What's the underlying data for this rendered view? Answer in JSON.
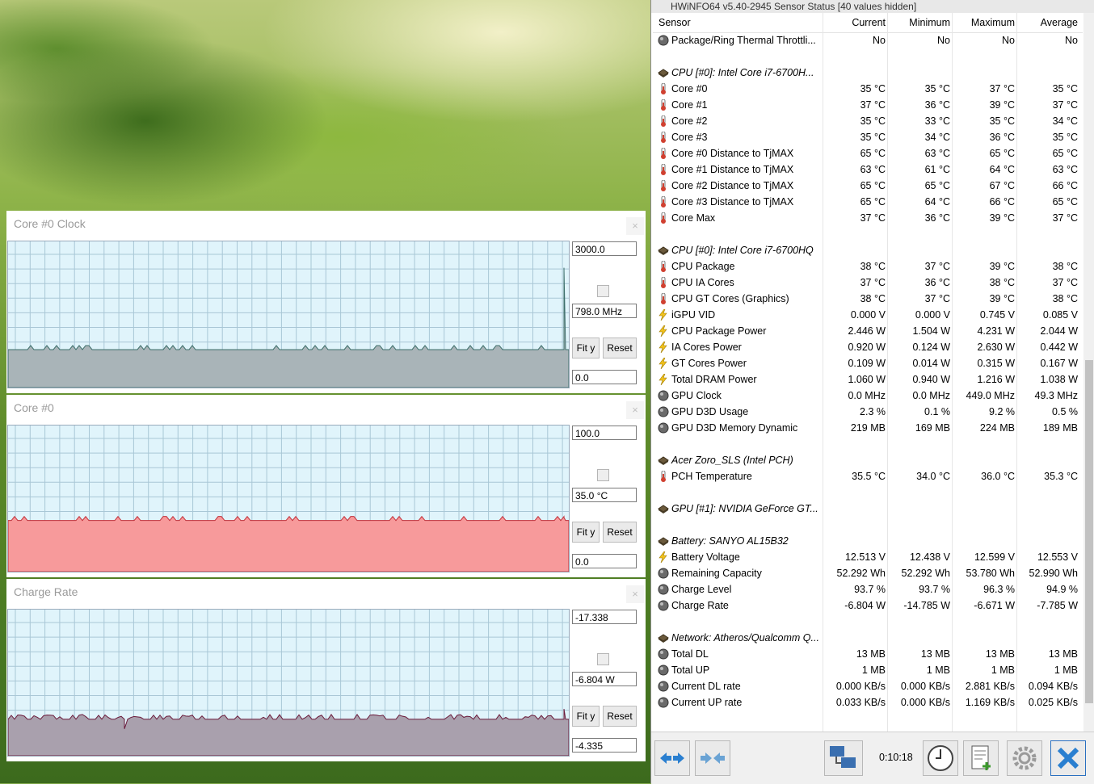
{
  "hwinfo": {
    "title": "HWiNFO64 v5.40-2945 Sensor Status [40 values hidden]",
    "headers": {
      "sensor": "Sensor",
      "current": "Current",
      "minimum": "Minimum",
      "maximum": "Maximum",
      "average": "Average"
    },
    "rows": [
      {
        "type": "item",
        "icon": "circle-icon",
        "name": "Package/Ring Thermal Throttli...",
        "cur": "No",
        "min": "No",
        "max": "No",
        "avg": "No"
      },
      {
        "type": "blank"
      },
      {
        "type": "group",
        "icon": "chip-icon",
        "name": "CPU [#0]: Intel Core i7-6700H..."
      },
      {
        "type": "item",
        "icon": "thermometer-icon",
        "name": "Core #0",
        "cur": "35 °C",
        "min": "35 °C",
        "max": "37 °C",
        "avg": "35 °C"
      },
      {
        "type": "item",
        "icon": "thermometer-icon",
        "name": "Core #1",
        "cur": "37 °C",
        "min": "36 °C",
        "max": "39 °C",
        "avg": "37 °C"
      },
      {
        "type": "item",
        "icon": "thermometer-icon",
        "name": "Core #2",
        "cur": "35 °C",
        "min": "33 °C",
        "max": "35 °C",
        "avg": "34 °C"
      },
      {
        "type": "item",
        "icon": "thermometer-icon",
        "name": "Core #3",
        "cur": "35 °C",
        "min": "34 °C",
        "max": "36 °C",
        "avg": "35 °C"
      },
      {
        "type": "item",
        "icon": "thermometer-icon",
        "name": "Core #0 Distance to TjMAX",
        "cur": "65 °C",
        "min": "63 °C",
        "max": "65 °C",
        "avg": "65 °C"
      },
      {
        "type": "item",
        "icon": "thermometer-icon",
        "name": "Core #1 Distance to TjMAX",
        "cur": "63 °C",
        "min": "61 °C",
        "max": "64 °C",
        "avg": "63 °C"
      },
      {
        "type": "item",
        "icon": "thermometer-icon",
        "name": "Core #2 Distance to TjMAX",
        "cur": "65 °C",
        "min": "65 °C",
        "max": "67 °C",
        "avg": "66 °C"
      },
      {
        "type": "item",
        "icon": "thermometer-icon",
        "name": "Core #3 Distance to TjMAX",
        "cur": "65 °C",
        "min": "64 °C",
        "max": "66 °C",
        "avg": "65 °C"
      },
      {
        "type": "item",
        "icon": "thermometer-icon",
        "name": "Core Max",
        "cur": "37 °C",
        "min": "36 °C",
        "max": "39 °C",
        "avg": "37 °C"
      },
      {
        "type": "blank"
      },
      {
        "type": "group",
        "icon": "chip-icon",
        "name": "CPU [#0]: Intel Core i7-6700HQ"
      },
      {
        "type": "item",
        "icon": "thermometer-icon",
        "name": "CPU Package",
        "cur": "38 °C",
        "min": "37 °C",
        "max": "39 °C",
        "avg": "38 °C"
      },
      {
        "type": "item",
        "icon": "thermometer-icon",
        "name": "CPU IA Cores",
        "cur": "37 °C",
        "min": "36 °C",
        "max": "38 °C",
        "avg": "37 °C"
      },
      {
        "type": "item",
        "icon": "thermometer-icon",
        "name": "CPU GT Cores (Graphics)",
        "cur": "38 °C",
        "min": "37 °C",
        "max": "39 °C",
        "avg": "38 °C"
      },
      {
        "type": "item",
        "icon": "lightning-icon",
        "name": "iGPU VID",
        "cur": "0.000 V",
        "min": "0.000 V",
        "max": "0.745 V",
        "avg": "0.085 V"
      },
      {
        "type": "item",
        "icon": "lightning-icon",
        "name": "CPU Package Power",
        "cur": "2.446 W",
        "min": "1.504 W",
        "max": "4.231 W",
        "avg": "2.044 W"
      },
      {
        "type": "item",
        "icon": "lightning-icon",
        "name": "IA Cores Power",
        "cur": "0.920 W",
        "min": "0.124 W",
        "max": "2.630 W",
        "avg": "0.442 W"
      },
      {
        "type": "item",
        "icon": "lightning-icon",
        "name": "GT Cores Power",
        "cur": "0.109 W",
        "min": "0.014 W",
        "max": "0.315 W",
        "avg": "0.167 W"
      },
      {
        "type": "item",
        "icon": "lightning-icon",
        "name": "Total DRAM Power",
        "cur": "1.060 W",
        "min": "0.940 W",
        "max": "1.216 W",
        "avg": "1.038 W"
      },
      {
        "type": "item",
        "icon": "circle-icon",
        "name": "GPU Clock",
        "cur": "0.0 MHz",
        "min": "0.0 MHz",
        "max": "449.0 MHz",
        "avg": "49.3 MHz"
      },
      {
        "type": "item",
        "icon": "circle-icon",
        "name": "GPU D3D Usage",
        "cur": "2.3 %",
        "min": "0.1 %",
        "max": "9.2 %",
        "avg": "0.5 %"
      },
      {
        "type": "item",
        "icon": "circle-icon",
        "name": "GPU D3D Memory Dynamic",
        "cur": "219 MB",
        "min": "169 MB",
        "max": "224 MB",
        "avg": "189 MB"
      },
      {
        "type": "blank"
      },
      {
        "type": "group",
        "icon": "chip-icon",
        "name": "Acer Zoro_SLS (Intel PCH)"
      },
      {
        "type": "item",
        "icon": "thermometer-icon",
        "name": "PCH Temperature",
        "cur": "35.5 °C",
        "min": "34.0 °C",
        "max": "36.0 °C",
        "avg": "35.3 °C"
      },
      {
        "type": "blank"
      },
      {
        "type": "group",
        "icon": "chip-icon",
        "name": "GPU [#1]: NVIDIA GeForce GT..."
      },
      {
        "type": "blank"
      },
      {
        "type": "group",
        "icon": "chip-icon",
        "name": "Battery: SANYO AL15B32"
      },
      {
        "type": "item",
        "icon": "lightning-icon",
        "name": "Battery Voltage",
        "cur": "12.513 V",
        "min": "12.438 V",
        "max": "12.599 V",
        "avg": "12.553 V"
      },
      {
        "type": "item",
        "icon": "circle-icon",
        "name": "Remaining Capacity",
        "cur": "52.292 Wh",
        "min": "52.292 Wh",
        "max": "53.780 Wh",
        "avg": "52.990 Wh"
      },
      {
        "type": "item",
        "icon": "circle-icon",
        "name": "Charge Level",
        "cur": "93.7 %",
        "min": "93.7 %",
        "max": "96.3 %",
        "avg": "94.9 %"
      },
      {
        "type": "item",
        "icon": "circle-icon",
        "name": "Charge Rate",
        "cur": "-6.804 W",
        "min": "-14.785 W",
        "max": "-6.671 W",
        "avg": "-7.785 W"
      },
      {
        "type": "blank"
      },
      {
        "type": "group",
        "icon": "chip-icon",
        "name": "Network: Atheros/Qualcomm Q..."
      },
      {
        "type": "item",
        "icon": "circle-icon",
        "name": "Total DL",
        "cur": "13 MB",
        "min": "13 MB",
        "max": "13 MB",
        "avg": "13 MB"
      },
      {
        "type": "item",
        "icon": "circle-icon",
        "name": "Total UP",
        "cur": "1 MB",
        "min": "1 MB",
        "max": "1 MB",
        "avg": "1 MB"
      },
      {
        "type": "item",
        "icon": "circle-icon",
        "name": "Current DL rate",
        "cur": "0.000 KB/s",
        "min": "0.000 KB/s",
        "max": "2.881 KB/s",
        "avg": "0.094 KB/s"
      },
      {
        "type": "item",
        "icon": "circle-icon",
        "name": "Current UP rate",
        "cur": "0.033 KB/s",
        "min": "0.000 KB/s",
        "max": "1.169 KB/s",
        "avg": "0.025 KB/s"
      }
    ],
    "toolbar": {
      "timer": "0:10:18",
      "buttons": [
        "arrows-expand-icon",
        "arrows-collapse-icon",
        "network-icon",
        "clock-icon",
        "report-add-icon",
        "gear-icon",
        "close-x-icon"
      ]
    }
  },
  "graphs": [
    {
      "title": "Core #0 Clock",
      "max_field": "3000.0",
      "current_field": "798.0 MHz",
      "min_field": "0.0",
      "fit_label": "Fit y",
      "reset_label": "Reset",
      "close_label": "×",
      "fill_color": "#a9b4b8",
      "line_color": "#3d6e6a",
      "baseline_level": 0.26,
      "spike_level": 0.82
    },
    {
      "title": "Core #0",
      "max_field": "100.0",
      "current_field": "35.0 °C",
      "min_field": "0.0",
      "fit_label": "Fit y",
      "reset_label": "Reset",
      "close_label": "×",
      "fill_color": "#f79a9b",
      "line_color": "#c0303a",
      "baseline_level": 0.35,
      "spike_level": 0.37
    },
    {
      "title": "Charge Rate",
      "max_field": "-17.338",
      "current_field": "-6.804 W",
      "min_field": "-4.335",
      "fit_label": "Fit y",
      "reset_label": "Reset",
      "close_label": "×",
      "fill_color": "#a9a0ad",
      "line_color": "#6a1a3a",
      "baseline_level": 0.25,
      "spike_level": 0.32
    }
  ]
}
